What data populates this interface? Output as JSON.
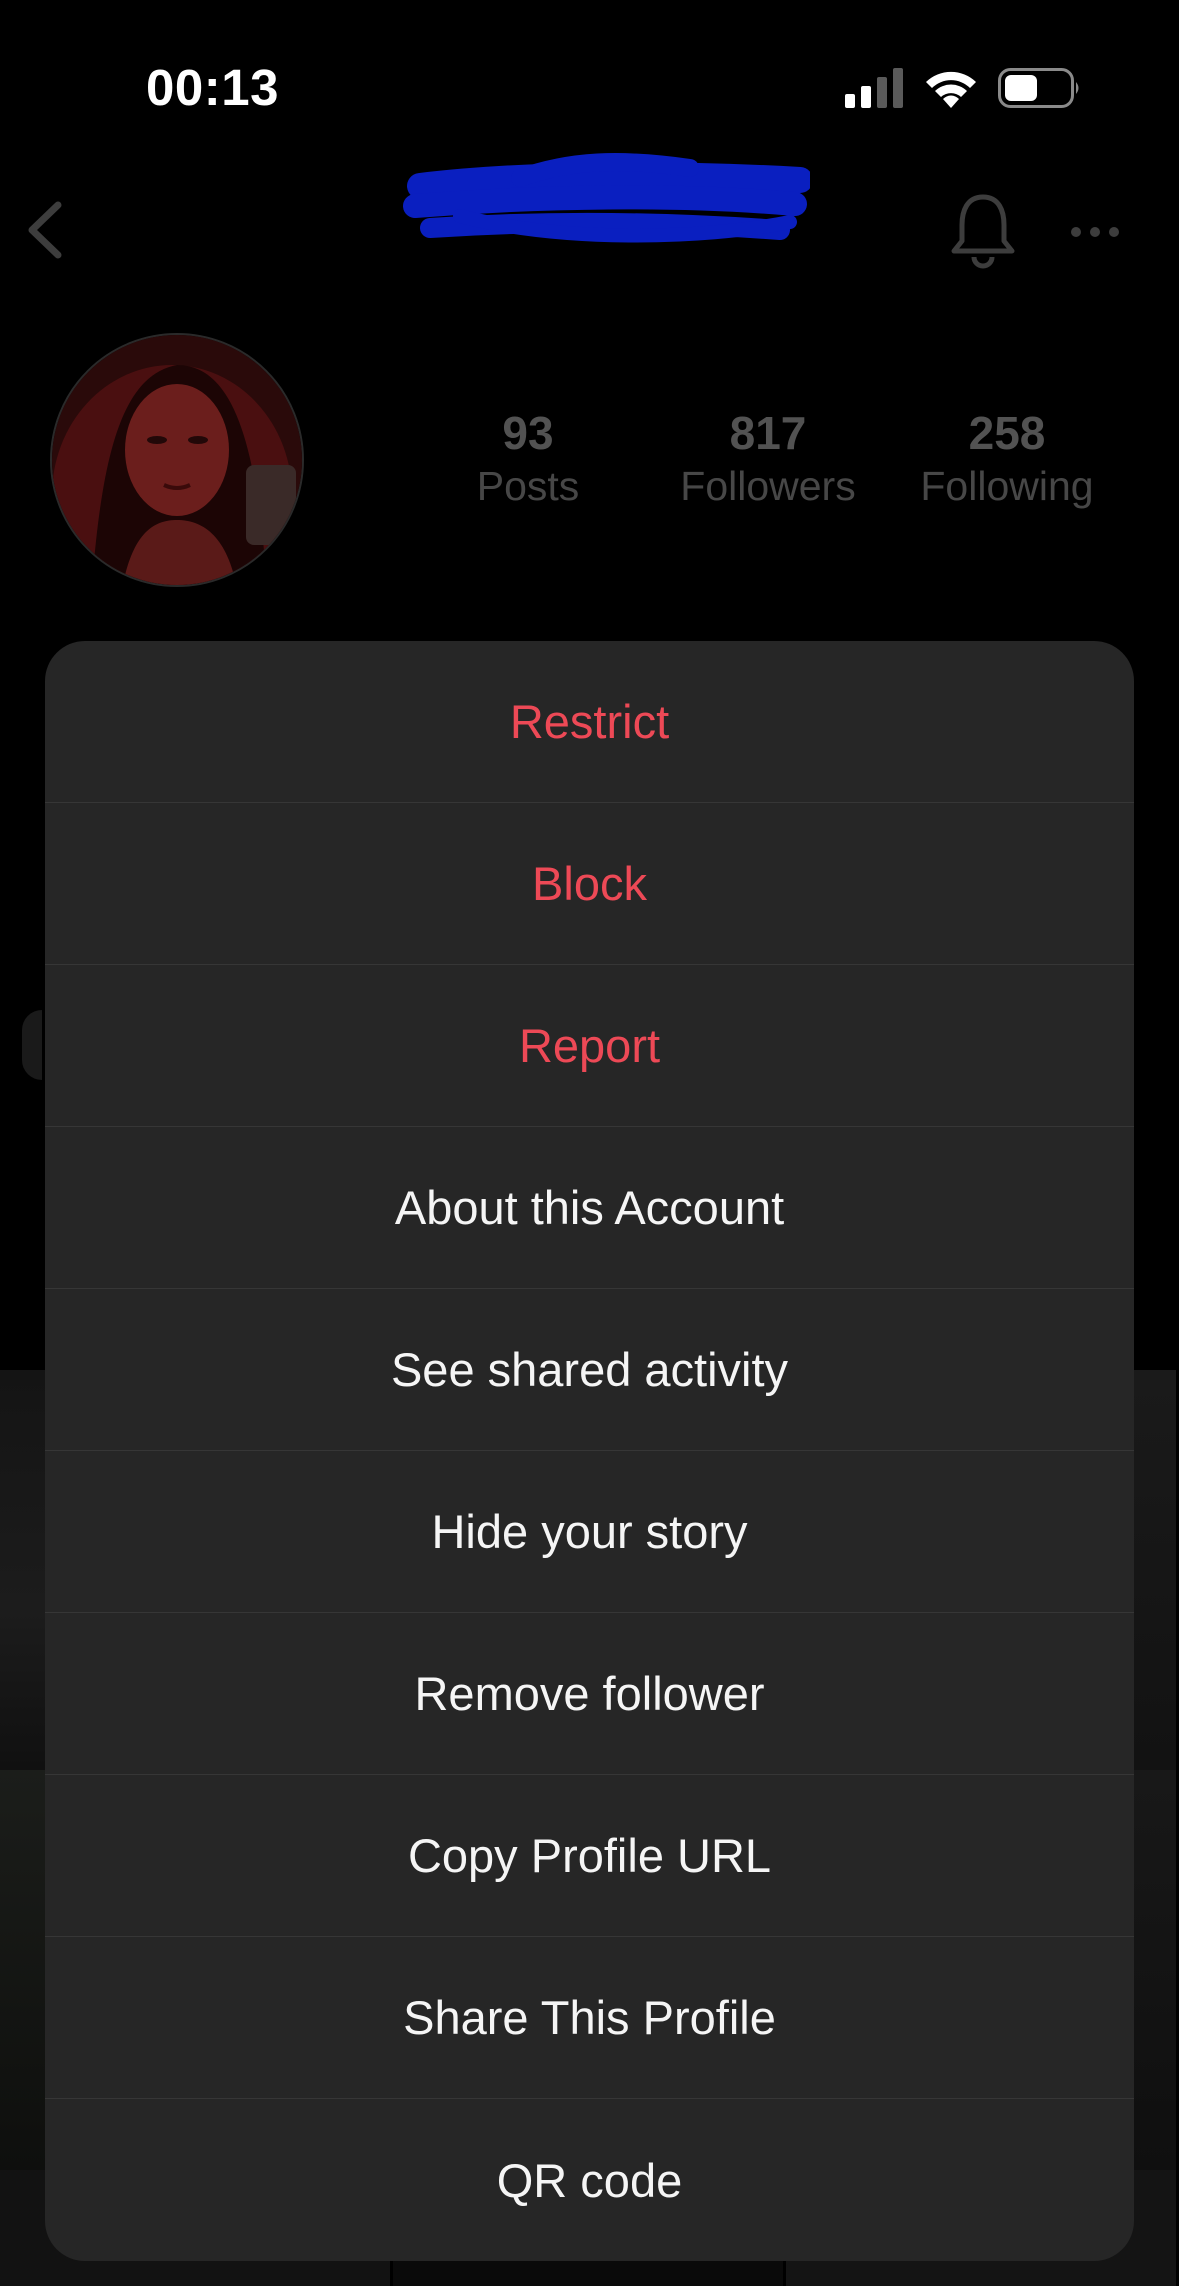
{
  "status_bar": {
    "time": "00:13",
    "icons": [
      "signal-icon",
      "wifi-icon",
      "battery-icon"
    ]
  },
  "header": {
    "username": "",
    "icons": [
      "back-chevron-icon",
      "bell-icon",
      "more-icon"
    ]
  },
  "profile": {
    "stats": [
      {
        "value": "93",
        "label": "Posts"
      },
      {
        "value": "817",
        "label": "Followers"
      },
      {
        "value": "258",
        "label": "Following"
      }
    ]
  },
  "menu": {
    "items": [
      {
        "label": "Restrict",
        "danger": true
      },
      {
        "label": "Block",
        "danger": true
      },
      {
        "label": "Report",
        "danger": true
      },
      {
        "label": "About this Account",
        "danger": false
      },
      {
        "label": "See shared activity",
        "danger": false
      },
      {
        "label": "Hide your story",
        "danger": false
      },
      {
        "label": "Remove follower",
        "danger": false
      },
      {
        "label": "Copy Profile URL",
        "danger": false
      },
      {
        "label": "Share This Profile",
        "danger": false
      },
      {
        "label": "QR code",
        "danger": false
      }
    ]
  },
  "colors": {
    "sheet_bg": "#262626",
    "danger": "#ed4956",
    "scribble": "#0a1fc0"
  }
}
